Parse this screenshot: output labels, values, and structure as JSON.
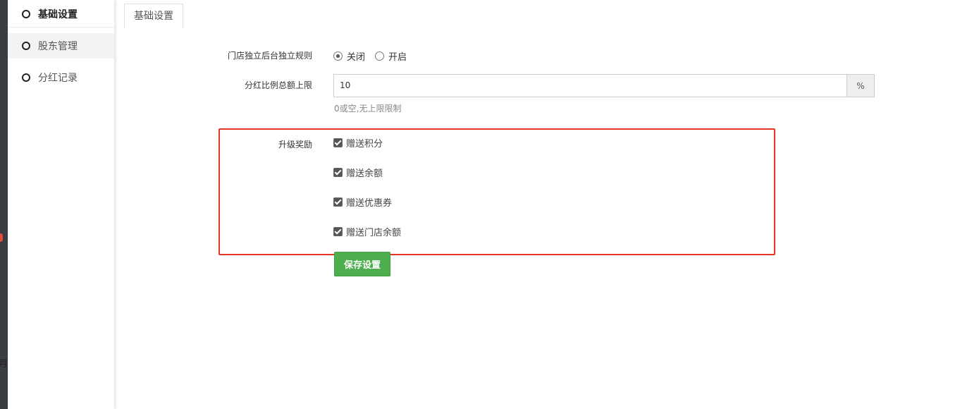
{
  "sidebar": {
    "items": [
      {
        "label": "基础设置",
        "active": true
      },
      {
        "label": "股东管理",
        "active": false
      },
      {
        "label": "分红记录",
        "active": false
      }
    ]
  },
  "outer": {
    "cut_char": "月"
  },
  "tabs": [
    {
      "label": "基础设置"
    }
  ],
  "form": {
    "independent_rule": {
      "label": "门店独立后台独立规则",
      "options": [
        "关闭",
        "开启"
      ],
      "selected": "关闭"
    },
    "dividend_limit": {
      "label": "分红比例总额上限",
      "value": "10",
      "addon": "%",
      "help": "0或空,无上限限制"
    },
    "upgrade_reward": {
      "label": "升级奖励",
      "options": [
        {
          "label": "赠送积分",
          "checked": true
        },
        {
          "label": "赠送余额",
          "checked": true
        },
        {
          "label": "赠送优惠券",
          "checked": true
        },
        {
          "label": "赠送门店余额",
          "checked": true
        }
      ]
    },
    "save_label": "保存设置"
  },
  "colors": {
    "accent_green": "#4cae4c",
    "highlight_red": "#e53326"
  }
}
